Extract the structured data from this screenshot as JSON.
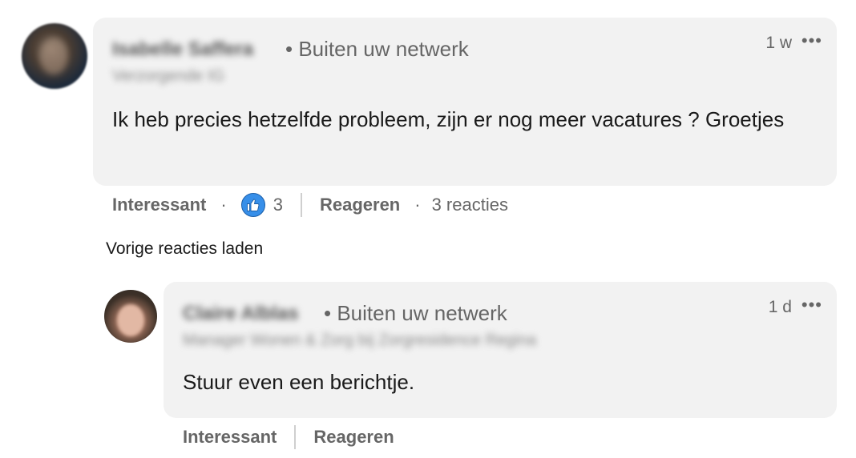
{
  "comment1": {
    "author_name": "Isabelle Saffera",
    "author_subtitle": "Verzorgende IG",
    "network": "• Buiten uw netwerk",
    "time": "1 w",
    "more": "•••",
    "text": "Ik heb precies hetzelfde probleem, zijn er nog meer vacatures ? Groetjes",
    "actions": {
      "like_label": "Interessant",
      "dot": "·",
      "reaction_count": "3",
      "reply_label": "Reageren",
      "replies_count": "3 reacties"
    }
  },
  "load_more": "Vorige reacties laden",
  "comment2": {
    "author_name": "Claire Alblas",
    "author_subtitle": "Manager Wonen & Zorg bij Zorgresidence Regina",
    "network": "• Buiten uw netwerk",
    "time": "1 d",
    "more": "•••",
    "text": "Stuur even een berichtje.",
    "actions": {
      "like_label": "Interessant",
      "reply_label": "Reageren"
    }
  },
  "colors": {
    "bubble": "#f2f2f2",
    "like_blue": "#378fe9",
    "muted_text": "#666666"
  },
  "icons": {
    "like": "thumbs-up-icon",
    "more": "more-options-icon"
  }
}
